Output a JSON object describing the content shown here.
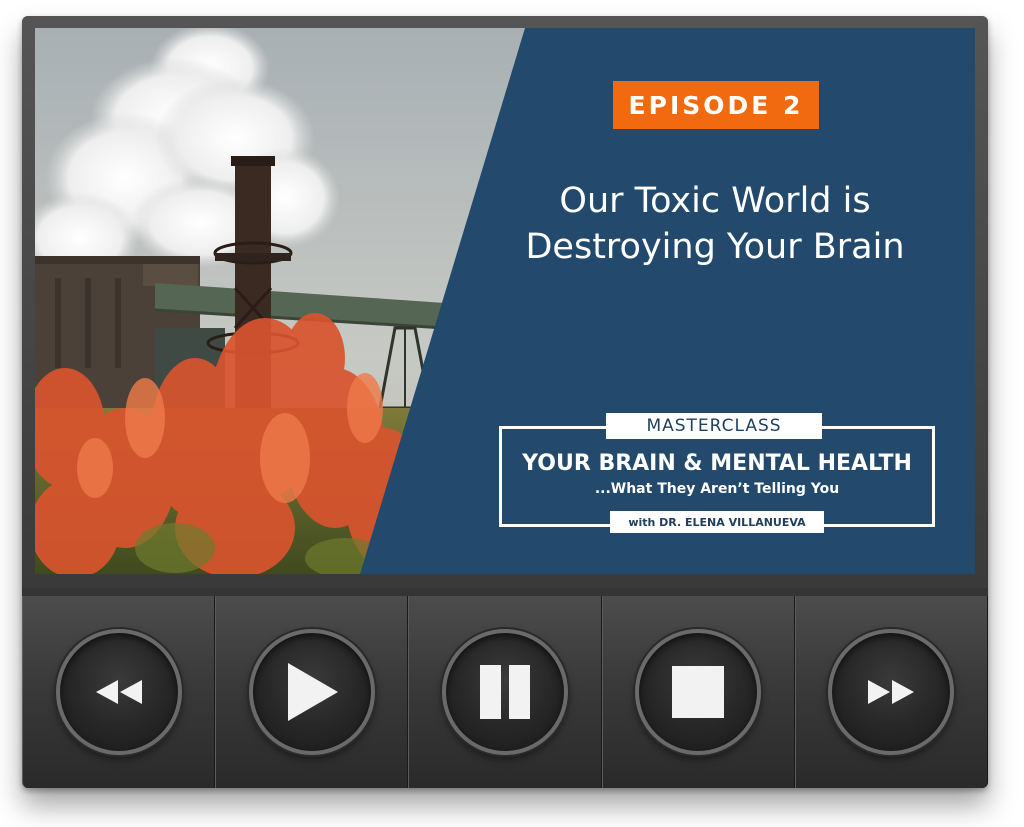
{
  "episode": {
    "label": "EPISODE 2"
  },
  "headline": {
    "line1": "Our Toxic World is",
    "line2": "Destroying Your Brain"
  },
  "masterclass": {
    "tag": "MASTERCLASS",
    "title": "YOUR BRAIN & MENTAL HEALTH",
    "subtitle": "...What They Aren’t Telling You",
    "host": "with DR. ELENA VILLANUEVA"
  },
  "controls": [
    {
      "name": "rewind",
      "icon": "rewind-icon"
    },
    {
      "name": "play",
      "icon": "play-icon"
    },
    {
      "name": "pause",
      "icon": "pause-icon"
    },
    {
      "name": "stop",
      "icon": "stop-icon"
    },
    {
      "name": "fast-forward",
      "icon": "fast-forward-icon"
    }
  ],
  "colors": {
    "badge": "#f26a0f",
    "panel_blue": "#234a6c",
    "frame": "#3a3a3a",
    "icon": "#f2f2f2"
  }
}
